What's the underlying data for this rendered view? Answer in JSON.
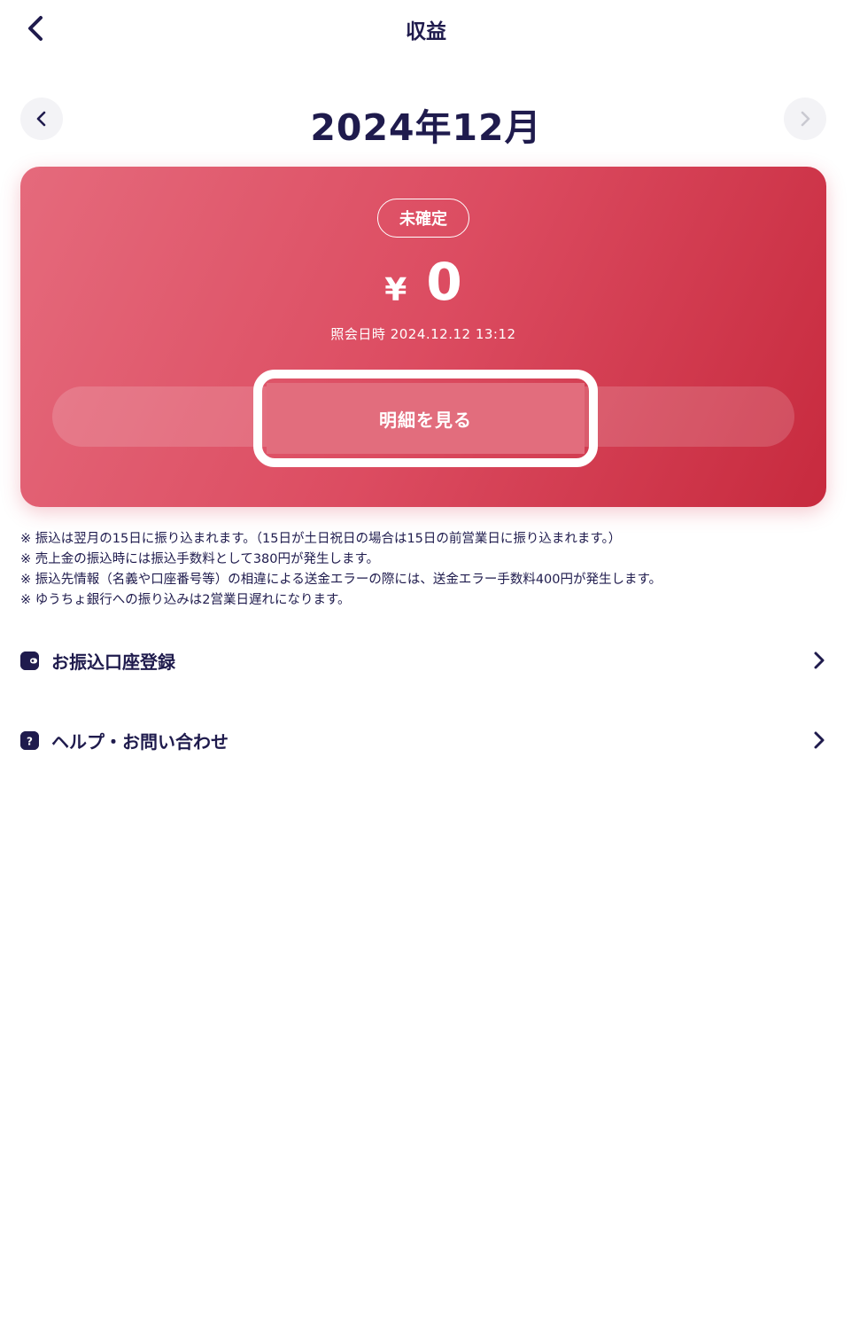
{
  "header": {
    "title": "収益"
  },
  "month": {
    "label": "2024年12月"
  },
  "card": {
    "status": "未確定",
    "currency": "¥",
    "amount": "0",
    "query_time": "照会日時 2024.12.12 13:12",
    "detail_button": "明細を見る",
    "colors": {
      "start": "#e56a7c",
      "end": "#c72a3e"
    }
  },
  "notes": [
    "※ 振込は翌月の15日に振り込まれます。（15日が土日祝日の場合は15日の前営業日に振り込まれます。）",
    "※ 売上金の振込時には振込手数料として380円が発生します。",
    "※ 振込先情報（名義や口座番号等）の相違による送金エラーの際には、送金エラー手数料400円が発生します。",
    "※ ゆうちょ銀行への振り込みは2営業日遅れになります。"
  ],
  "menu": [
    {
      "label": "お振込口座登録",
      "icon": "wallet-icon"
    },
    {
      "label": "ヘルプ・お問い合わせ",
      "icon": "help-icon"
    }
  ]
}
